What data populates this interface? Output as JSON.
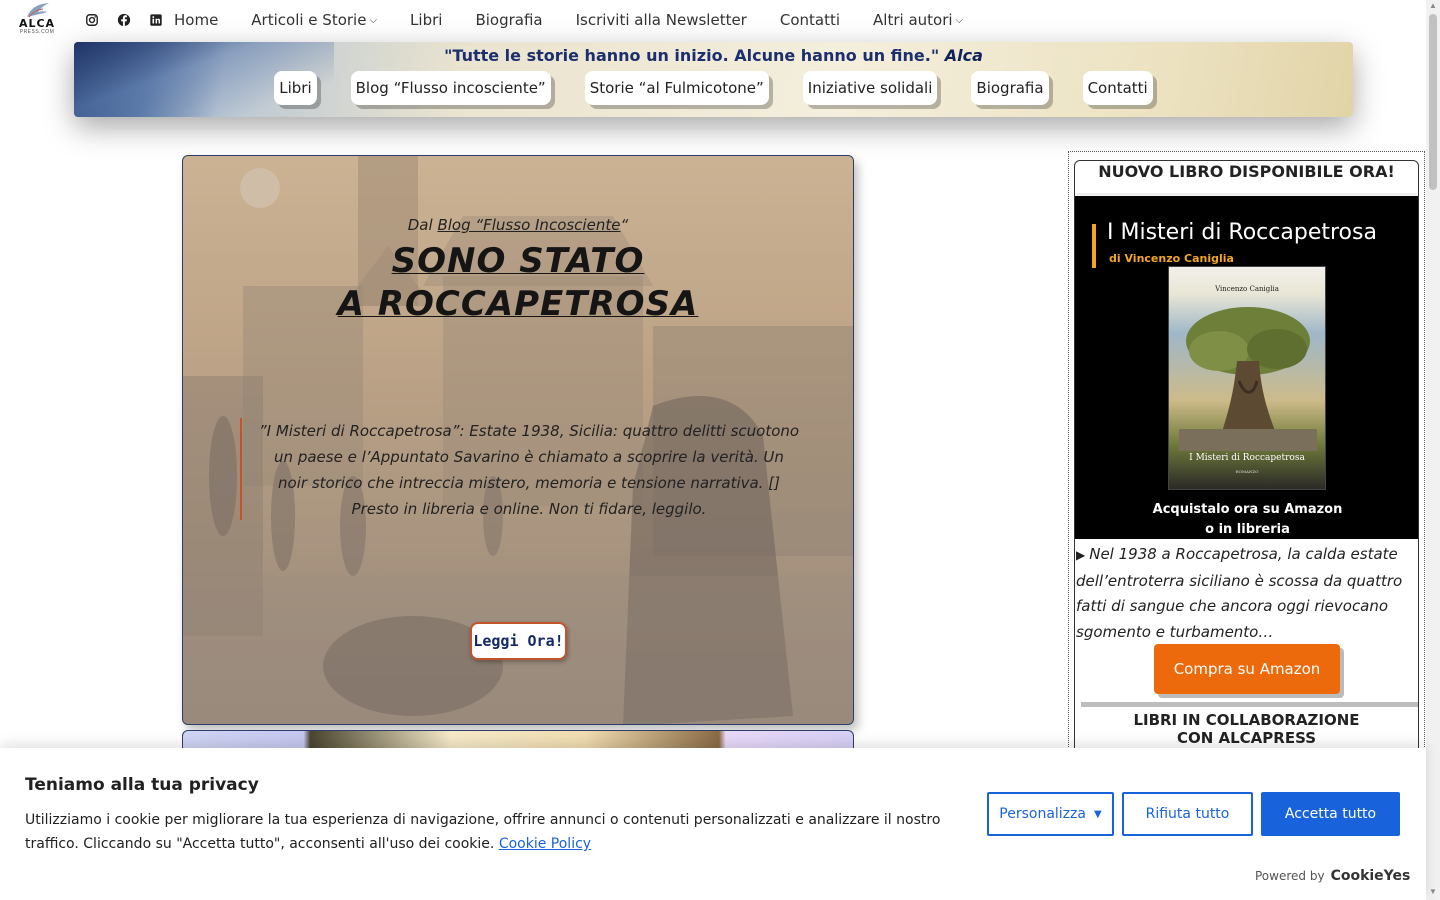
{
  "logo": {
    "text": "ALCA",
    "sub": "PRESS.COM"
  },
  "colors": {
    "accent_orange": "#ec6a0b",
    "cookie_blue": "#1863dc",
    "banner_quote": "#1b2f6e",
    "hero_accent": "#c2542b"
  },
  "social": [
    {
      "name": "instagram-icon"
    },
    {
      "name": "facebook-icon"
    },
    {
      "name": "linkedin-icon"
    }
  ],
  "nav": {
    "items": [
      {
        "label": "Home"
      },
      {
        "label": "Articoli e Storie",
        "dropdown": true
      },
      {
        "label": "Libri"
      },
      {
        "label": "Biografia"
      },
      {
        "label": "Iscriviti alla Newsletter"
      },
      {
        "label": "Contatti"
      },
      {
        "label": "Altri autori",
        "dropdown": true
      }
    ]
  },
  "banner": {
    "quote": "\"Tutte le storie hanno un inizio. Alcune hanno un fine.\"",
    "quote_author": "Alca",
    "pills": [
      "Libri",
      "Blog “Flusso incosciente”",
      "Storie “al Fulmicotone”",
      "Iniziative solidali",
      "Biografia",
      "Contatti"
    ]
  },
  "hero": {
    "from_prefix": "Dal ",
    "from_link": "Blog “Flusso Incosciente",
    "from_suffix": "“",
    "title_line1": "SONO STATO",
    "title_line2": "A ROCCAPETROSA",
    "quote": "”I Misteri di Roccapetrosa”: Estate 1938, Sicilia: quattro delitti scuotono un paese e l’Appuntato Savarino è chiamato a scoprire la verità. Un noir storico che intreccia mistero, memoria e tensione narrativa. [] Presto in libreria e online. Non ti fidare, leggilo.",
    "button": "Leggi Ora!"
  },
  "sidebar": {
    "heading": "NUOVO LIBRO DISPONIBILE ORA!",
    "book_title": "I Misteri di Roccapetrosa",
    "book_author": "di Vincenzo Caniglia",
    "cover_author": "Vincenzo Caniglia",
    "cover_title": "I Misteri di Roccapetrosa",
    "cover_sub": "ROMANZO",
    "cta_line1": "Acquistalo ora su Amazon",
    "cta_line2": "o in libreria",
    "description": "Nel 1938 a Roccapetrosa, la calda estate dell’entroterra siciliano è scossa da quattro fatti di sangue che ancora oggi rievocano sgomento e turbamento…",
    "amazon_button": "Compra su Amazon",
    "collab_line1": "LIBRI IN COLLABORAZIONE",
    "collab_line2": "CON ALCAPRESS"
  },
  "cookie": {
    "title": "Teniamo alla tua privacy",
    "text": "Utilizziamo i cookie per migliorare la tua esperienza di navigazione, offrire annunci o contenuti personalizzati e analizzare il nostro traffico. Cliccando su \"Accetta tutto\", acconsenti all'uso dei cookie.",
    "policy_link": "Cookie Policy",
    "customize": "Personalizza",
    "reject": "Rifiuta tutto",
    "accept": "Accetta tutto",
    "powered_by": "Powered by",
    "brand": "CookieYes"
  }
}
